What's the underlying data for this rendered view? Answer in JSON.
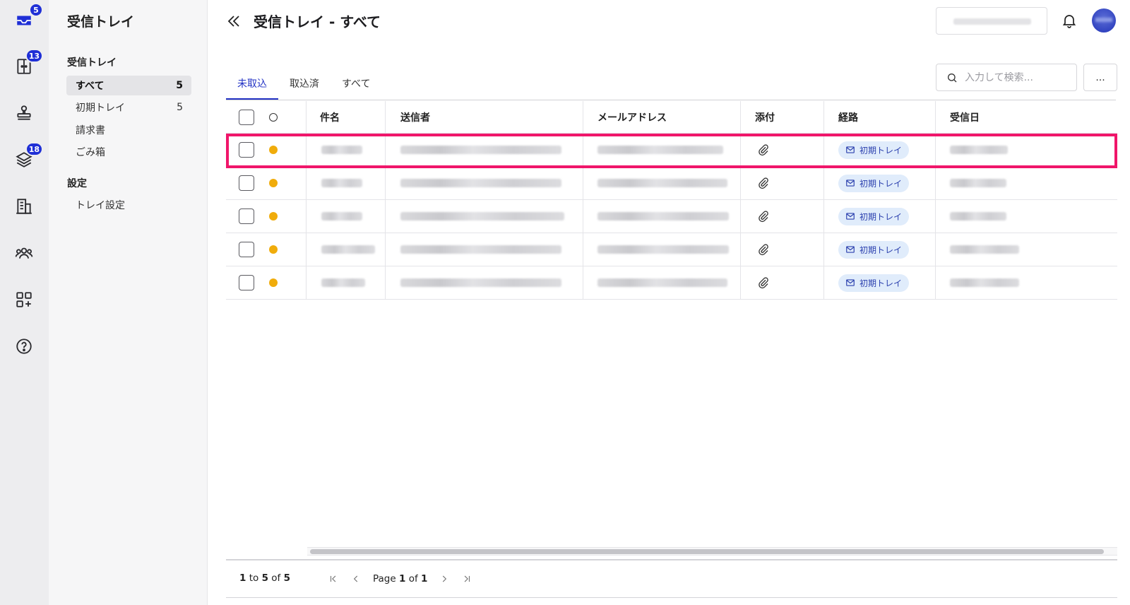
{
  "rail": {
    "items": [
      {
        "icon": "inbox-icon",
        "badge": "5"
      },
      {
        "icon": "door-icon",
        "badge": "13"
      },
      {
        "icon": "stamp-icon",
        "badge": ""
      },
      {
        "icon": "layers-icon",
        "badge": "18"
      },
      {
        "icon": "building-icon",
        "badge": ""
      },
      {
        "icon": "users-icon",
        "badge": ""
      },
      {
        "icon": "apps-add-icon",
        "badge": ""
      },
      {
        "icon": "help-icon",
        "badge": ""
      }
    ]
  },
  "sidebar": {
    "title": "受信トレイ",
    "section_inbox": "受信トレイ",
    "items": [
      {
        "label": "すべて",
        "count": "5"
      },
      {
        "label": "初期トレイ",
        "count": "5"
      },
      {
        "label": "請求書",
        "count": ""
      },
      {
        "label": "ごみ箱",
        "count": ""
      }
    ],
    "section_settings": "設定",
    "settings_items": [
      {
        "label": "トレイ設定"
      }
    ]
  },
  "header": {
    "title": "受信トレイ - すべて"
  },
  "tabs": [
    {
      "label": "未取込"
    },
    {
      "label": "取込済"
    },
    {
      "label": "すべて"
    }
  ],
  "search": {
    "placeholder": "入力して検索..."
  },
  "more_label": "...",
  "table": {
    "columns": [
      "件名",
      "送信者",
      "メールアドレス",
      "添付",
      "経路",
      "受信日"
    ],
    "rows": [
      {
        "route": "初期トレイ"
      },
      {
        "route": "初期トレイ"
      },
      {
        "route": "初期トレイ"
      },
      {
        "route": "初期トレイ"
      },
      {
        "route": "初期トレイ"
      }
    ]
  },
  "footer": {
    "range_start": "1",
    "range_to": "to",
    "range_end": "5",
    "range_of": "of",
    "total": "5",
    "page_word": "Page",
    "page_current": "1",
    "page_of": "of",
    "page_total": "1"
  },
  "colors": {
    "accent": "#2232c4",
    "badge": "#1f2fd6",
    "unread_dot": "#f0ac0b",
    "highlight": "#f0166a",
    "route_chip_bg": "#e0ecfb"
  }
}
